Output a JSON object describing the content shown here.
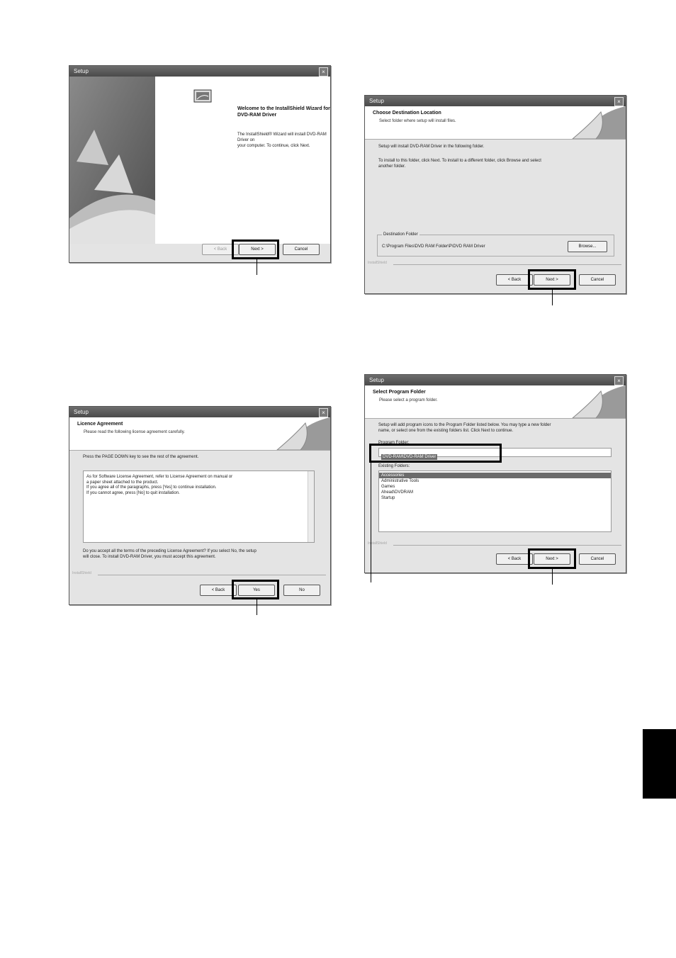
{
  "dialog_title": "Setup",
  "close_glyph": "×",
  "installshield": "InstallShield",
  "buttons": {
    "back": "< Back",
    "next": "Next >",
    "cancel": "Cancel",
    "yes": "Yes",
    "no": "No",
    "browse": "Browse..."
  },
  "welcome": {
    "heading_line1": "Welcome to the InstallShield Wizard for",
    "heading_line2": "DVD-RAM Driver",
    "body_line1": "The InstallShield® Wizard will install DVD-RAM Driver on",
    "body_line2": "your computer.  To continue, click Next."
  },
  "license": {
    "title": "Licence Agreement",
    "subtitle": "Please read the following license agreement carefully.",
    "instruction": "Press the PAGE DOWN key to see the rest of the agreement.",
    "text_lines": [
      "As for Software License Agreement, refer to License Agreement on manual or",
      "a paper sheet attached to the product.",
      "If you agree all of the paragraphs, press [Yes] to continue installation.",
      "If you cannot agree, press [No] to quit installation."
    ],
    "question_line1": "Do you accept all the terms of the preceding License Agreement?  If you select No,  the setup",
    "question_line2": "will close.  To install DVD-RAM Driver, you must accept this agreement."
  },
  "destination": {
    "title": "Choose Destination Location",
    "subtitle": "Select folder where setup will install files.",
    "line1": "Setup will install DVD-RAM Driver in the following folder.",
    "line2a": "To install to this folder, click Next.  To install to a different folder, click Browse and select",
    "line2b": "another folder.",
    "group_label": "Destination Folder",
    "path": "C:\\Program Files\\DVD RAM Folder\\P\\DVD RAM Driver"
  },
  "program_folder": {
    "title": "Select Program Folder",
    "subtitle": "Please select a program folder.",
    "line1": "Setup will add program icons to the Program Folder listed below.  You may type a new folder",
    "line2": "name, or select one from the existing folders list.  Click Next to continue.",
    "field_label": "Program Folder:",
    "field_value": "DVD-RAM\\DVD-RAM Driver",
    "list_label": "Existing Folders:",
    "folders": [
      "Accessories",
      "Administrative Tools",
      "Games",
      "Ahead\\DVDRAM",
      "Startup"
    ]
  }
}
